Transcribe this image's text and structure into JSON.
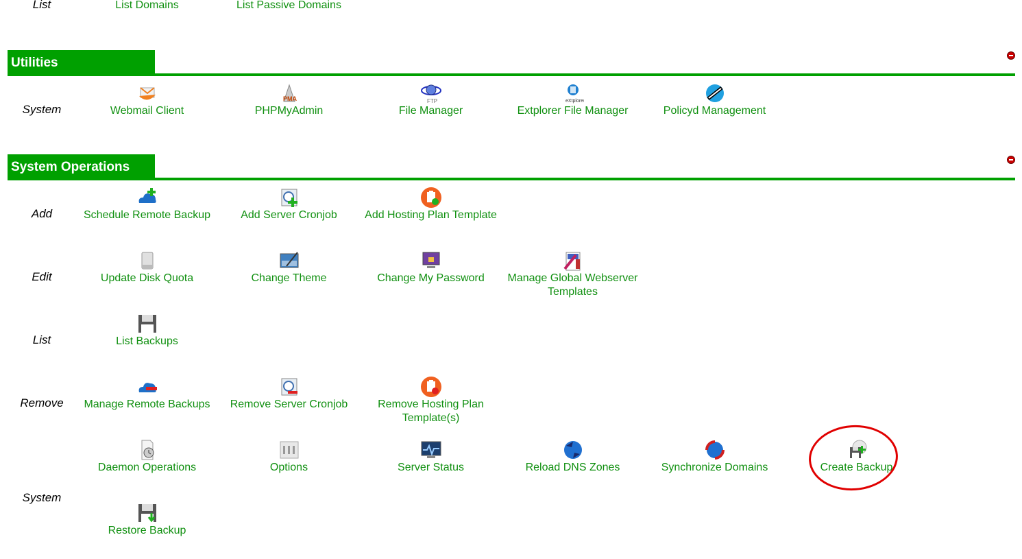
{
  "top_row": {
    "label": "List",
    "links": [
      "List Domains",
      "List Passive Domains"
    ]
  },
  "utilities": {
    "title": "Utilities",
    "row_label": "System",
    "items": [
      {
        "label": "Webmail Client",
        "icon": "webmail-icon"
      },
      {
        "label": "PHPMyAdmin",
        "icon": "phpmyadmin-icon"
      },
      {
        "label": "File Manager",
        "icon": "ftp-file-manager-icon"
      },
      {
        "label": "Extplorer File Manager",
        "icon": "extplorer-icon"
      },
      {
        "label": "Policyd Management",
        "icon": "policyd-icon"
      }
    ]
  },
  "system_operations": {
    "title": "System Operations",
    "rows": {
      "add": {
        "label": "Add",
        "items": [
          {
            "label": "Schedule Remote Backup",
            "icon": "cloud-add-icon"
          },
          {
            "label": "Add Server Cronjob",
            "icon": "clock-add-icon"
          },
          {
            "label": "Add Hosting Plan Template",
            "icon": "clipboard-add-icon"
          }
        ]
      },
      "edit": {
        "label": "Edit",
        "items": [
          {
            "label": "Update Disk Quota",
            "icon": "disk-icon"
          },
          {
            "label": "Change Theme",
            "icon": "theme-icon"
          },
          {
            "label": "Change My Password",
            "icon": "password-icon"
          },
          {
            "label": "Manage Global Webserver Templates",
            "icon": "templates-icon"
          }
        ]
      },
      "list": {
        "label": "List",
        "items": [
          {
            "label": "List Backups",
            "icon": "floppy-icon"
          }
        ]
      },
      "remove": {
        "label": "Remove",
        "items": [
          {
            "label": "Manage Remote Backups",
            "icon": "cloud-remove-icon"
          },
          {
            "label": "Remove Server Cronjob",
            "icon": "clock-remove-icon"
          },
          {
            "label": "Remove Hosting Plan Template(s)",
            "icon": "clipboard-remove-icon"
          }
        ]
      },
      "system": {
        "label": "System",
        "items": [
          {
            "label": "Daemon Operations",
            "icon": "daemon-icon"
          },
          {
            "label": "Options",
            "icon": "options-icon"
          },
          {
            "label": "Server Status",
            "icon": "server-status-icon"
          },
          {
            "label": "Reload DNS Zones",
            "icon": "dns-reload-icon"
          },
          {
            "label": "Synchronize Domains",
            "icon": "sync-icon"
          },
          {
            "label": "Create Backup",
            "icon": "create-backup-icon"
          },
          {
            "label": "Restore Backup",
            "icon": "restore-backup-icon"
          }
        ]
      }
    }
  },
  "colors": {
    "accent_green": "#00a000",
    "link_green": "#109010",
    "annotation_red": "#e00000"
  }
}
